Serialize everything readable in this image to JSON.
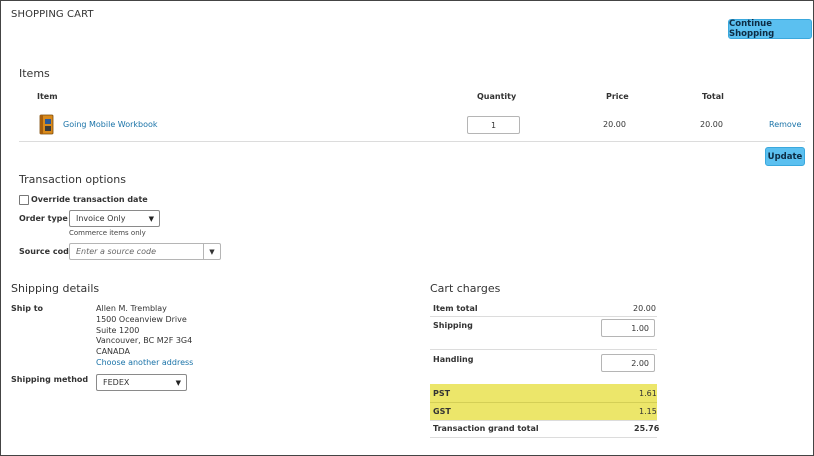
{
  "header": {
    "title": "SHOPPING CART",
    "continue_label": "Continue Shopping"
  },
  "items": {
    "title": "Items",
    "columns": {
      "item": "Item",
      "quantity": "Quantity",
      "price": "Price",
      "total": "Total"
    },
    "rows": [
      {
        "name": "Going Mobile Workbook",
        "quantity": "1",
        "price": "20.00",
        "total": "20.00",
        "remove": "Remove",
        "icon": "book-icon"
      }
    ],
    "update_label": "Update"
  },
  "transaction": {
    "title": "Transaction options",
    "override_label": "Override transaction date",
    "override_checked": false,
    "order_type_label": "Order type",
    "order_type_value": "Invoice Only",
    "order_type_hint": "Commerce items only",
    "source_code_label": "Source code",
    "source_code_placeholder": "Enter a source code"
  },
  "shipping": {
    "title": "Shipping details",
    "ship_to_label": "Ship to",
    "address": [
      "Allen M. Tremblay",
      "1500 Oceanview Drive",
      "Suite 1200",
      "Vancouver, BC M2F 3G4",
      "CANADA"
    ],
    "choose_link": "Choose another address",
    "method_label": "Shipping method",
    "method_value": "FEDEX"
  },
  "charges": {
    "title": "Cart charges",
    "item_total_label": "Item total",
    "item_total": "20.00",
    "shipping_label": "Shipping",
    "shipping_value": "1.00",
    "handling_label": "Handling",
    "handling_value": "2.00",
    "pst_label": "PST",
    "pst_value": "1.61",
    "gst_label": "GST",
    "gst_value": "1.15",
    "grand_total_label": "Transaction grand total",
    "grand_total": "25.76",
    "highlight_color": "#ece66a"
  }
}
